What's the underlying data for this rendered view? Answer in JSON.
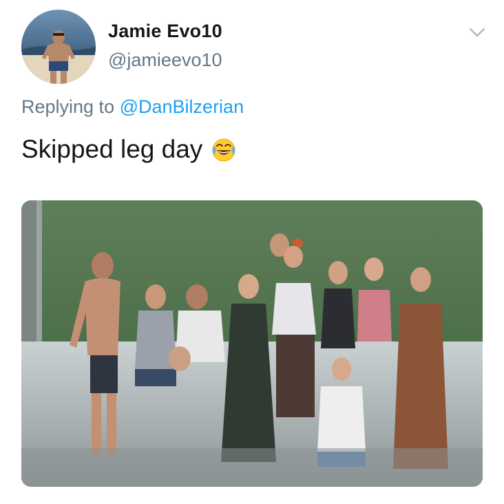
{
  "tweet": {
    "display_name": "Jamie Evo10",
    "handle": "@jamieevo10",
    "replying_prefix": "Replying to",
    "replying_mention": "@DanBilzerian",
    "text": "Skipped leg day",
    "emoji": "face-with-tears-of-joy",
    "chevron_icon": "chevron-down-icon"
  },
  "colors": {
    "primary_text": "#14171a",
    "secondary_text": "#657786",
    "link": "#1da1f2"
  }
}
